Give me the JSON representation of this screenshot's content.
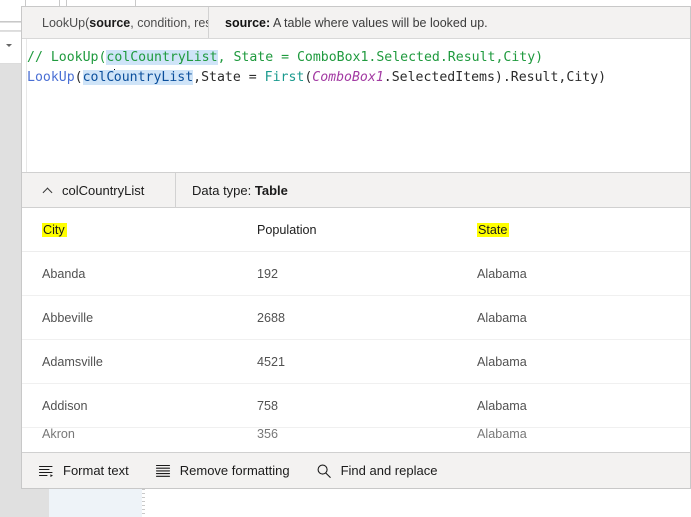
{
  "signature": {
    "name": "signature-tooltip",
    "prefix": "LookUp(",
    "param_bold": "source",
    "rest": ", condition, result)",
    "desc_bold": "source:",
    "desc_text": " A table where values will be looked up."
  },
  "formula": {
    "line1": {
      "comment_start": "// LookUp(",
      "highlight": "colCountryList",
      "comment_end": ", State = ComboBox1.Selected.Result,City)"
    },
    "line2": {
      "func": "LookUp",
      "open_paren": "(",
      "highlight_pre": "colC",
      "highlight_post": "ountryList",
      "mid": ",State = ",
      "first": "First",
      "paren2": "(",
      "control": "ComboBox1",
      "tail": ".SelectedItems).Result,City)"
    }
  },
  "result": {
    "variable_name": "colCountryList",
    "datatype_label": "Data type:",
    "datatype_value": "Table",
    "collapse_icon": "chevron-up-icon"
  },
  "table": {
    "columns": [
      "City",
      "Population",
      "State"
    ],
    "highlighted_columns": [
      "City",
      "State"
    ],
    "rows": [
      {
        "city": "Abanda",
        "population": "192",
        "state": "Alabama"
      },
      {
        "city": "Abbeville",
        "population": "2688",
        "state": "Alabama"
      },
      {
        "city": "Adamsville",
        "population": "4521",
        "state": "Alabama"
      },
      {
        "city": "Addison",
        "population": "758",
        "state": "Alabama"
      },
      {
        "city": "Akron",
        "population": "356",
        "state": "Alabama"
      }
    ]
  },
  "commands": [
    {
      "label": "Format text",
      "icon": "format-text-icon"
    },
    {
      "label": "Remove formatting",
      "icon": "remove-formatting-icon"
    },
    {
      "label": "Find and replace",
      "icon": "search-icon"
    }
  ],
  "colors": {
    "highlight_yellow": "#ffff00",
    "selection_blue": "#cfe4f8",
    "comment_green": "#1f9a3e",
    "identifier_blue": "#0b4f9c",
    "function_blue": "#4a6fd4",
    "control_purple": "#a33ba3",
    "first_teal": "#1a9a8e",
    "chrome_gray": "#f3f2f1"
  }
}
